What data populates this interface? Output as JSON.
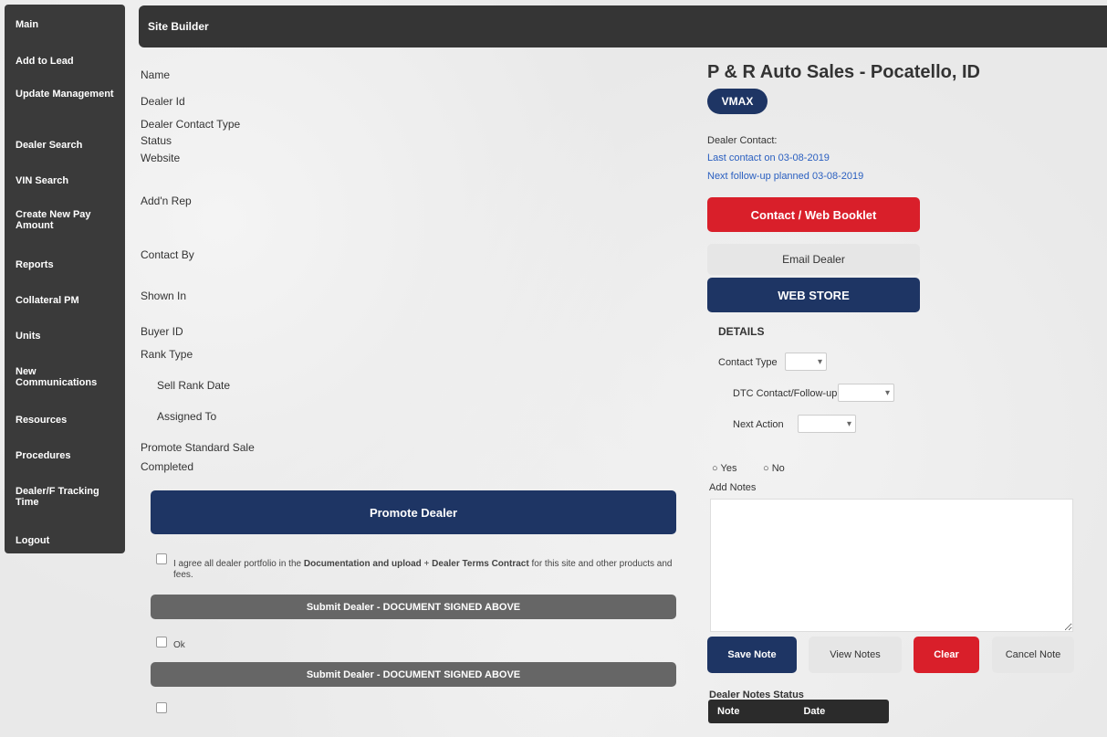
{
  "sidebar": {
    "items": [
      {
        "label": "Main"
      },
      {
        "label": "Add to Lead"
      },
      {
        "label": "Update Management"
      },
      {
        "label": "Dealer Search"
      },
      {
        "label": "VIN Search"
      },
      {
        "label": "Create New Pay Amount"
      },
      {
        "label": "Reports"
      },
      {
        "label": "Collateral PM"
      },
      {
        "label": "Units"
      },
      {
        "label": "New Communications"
      },
      {
        "label": "Resources"
      },
      {
        "label": "Procedures"
      },
      {
        "label": "Dealer/F Tracking Time"
      },
      {
        "label": "Logout"
      }
    ]
  },
  "header": {
    "title": "Site Builder"
  },
  "form": {
    "labels": {
      "name": "Name",
      "dealer_id": "Dealer Id",
      "dealer_contact_type": "Dealer Contact Type",
      "status": "Status",
      "website": "Website",
      "add_by": "Add'n Rep",
      "contact_by": "Contact By",
      "shown_in": "Shown In",
      "buyer_id": "Buyer ID",
      "rank_type": "Rank Type",
      "sub_rank_date": "Sell Rank Date",
      "assigned_to": "Assigned To",
      "promote_date": "Promote Standard Sale",
      "completed": "Completed"
    },
    "promote_button": "Promote Dealer",
    "terms_text": "I agree all dealer portfolio in the",
    "terms_link_1": "Documentation and upload",
    "terms_mid": "+",
    "terms_link_2": "Dealer Terms Contract",
    "terms_tail": "for this site and other products and fees.",
    "grey_bar_1": "Submit Dealer - DOCUMENT SIGNED ABOVE",
    "ok_label": "Ok",
    "grey_bar_2": "Submit Dealer - DOCUMENT SIGNED ABOVE"
  },
  "dealer": {
    "title": "P & R Auto Sales - Pocatello, ID",
    "badge": "VMAX",
    "contact_label": "Dealer Contact:",
    "link_1": "Last contact on 03-08-2019",
    "link_2": "Next follow-up planned 03-08-2019",
    "contact_button": "Contact / Web Booklet",
    "email_button": "Email Dealer",
    "web_button": "WEB STORE",
    "section_title": "DETAILS",
    "contact_type_label": "Contact Type",
    "follow_up_label": "DTC Contact/Follow-up",
    "next_action_label": "Next Action",
    "radio_1": "Yes",
    "radio_2": "No",
    "notes_label": "Add Notes",
    "note_buttons": [
      "Save Note",
      "View Notes",
      "Clear",
      "Cancel Note"
    ],
    "bottom_label": "Dealer Notes Status",
    "bottom_strip": [
      "Note",
      "Date"
    ]
  }
}
